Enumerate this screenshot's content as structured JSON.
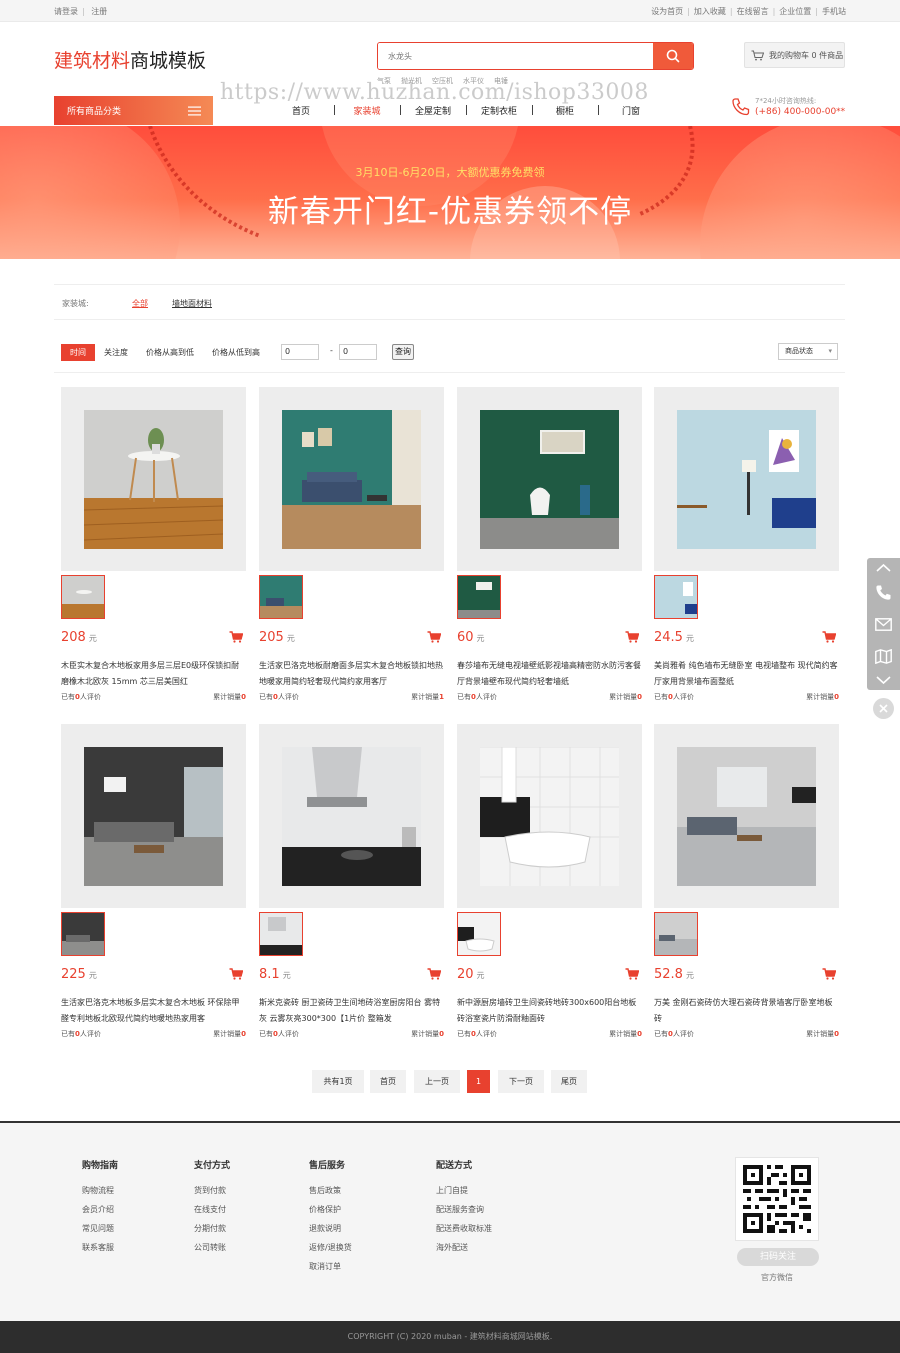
{
  "topbar": {
    "login": "请登录",
    "register": "注册",
    "links": [
      "设为首页",
      "加入收藏",
      "在线留言",
      "企业位置",
      "手机站"
    ]
  },
  "header": {
    "logo_red": "建筑材料",
    "logo_dark": "商城模板",
    "search_placeholder": "水龙头",
    "hotwords": [
      "气泵",
      "抛光机",
      "空压机",
      "水平仪",
      "电锤"
    ],
    "cart_label": "我的购物车 0 件商品",
    "all_categories": "所有商品分类",
    "nav": [
      "首页",
      "家装城",
      "全屋定制",
      "定制衣柜",
      "橱柜",
      "门窗"
    ],
    "nav_active_index": 1,
    "hotline_label": "7*24小时咨询热线:",
    "hotline_number": "(+86) 400-000-00**",
    "watermark": "https://www.huzhan.com/ishop33008"
  },
  "banner": {
    "subtitle": "3月10日-6月20日，大额优惠券免费领",
    "title": "新春开门红-优惠券领不停"
  },
  "filters": {
    "category_label": "家装城:",
    "all": "全部",
    "sub": "墙地面材料",
    "sort": [
      "时间",
      "关注度",
      "价格从高到低",
      "价格从低到高"
    ],
    "price_min": "0",
    "price_max": "0",
    "dash": "-",
    "query": "查询",
    "status": "商品状态"
  },
  "products": [
    {
      "price": "208",
      "unit": "元",
      "name": "木臣实木复合木地板家用多层三层E0级环保锁扣耐磨橡木北欧灰 15mm 芯三层美国红",
      "review_pre": "已有",
      "reviews": "0",
      "review_post": "人评价",
      "sales_label": "累计销量",
      "sales": "0"
    },
    {
      "price": "205",
      "unit": "元",
      "name": "生活家巴洛克地板耐磨面多层实木复合地板锁扣地热地暖家用简约轻奢现代简约家用客厅",
      "review_pre": "已有",
      "reviews": "0",
      "review_post": "人评价",
      "sales_label": "累计销量",
      "sales": "1"
    },
    {
      "price": "60",
      "unit": "元",
      "name": "春莎墙布无缝电视墙壁纸影视墙高精密防水防污客餐厅背景墙壁布现代简约轻奢墙纸",
      "review_pre": "已有",
      "reviews": "0",
      "review_post": "人评价",
      "sales_label": "累计销量",
      "sales": "0"
    },
    {
      "price": "24.5",
      "unit": "元",
      "name": "美尚雅肴 纯色墙布无缝卧室 电视墙整布 现代简约客厅家用背景墙布面整纸",
      "review_pre": "已有",
      "reviews": "0",
      "review_post": "人评价",
      "sales_label": "累计销量",
      "sales": "0"
    },
    {
      "price": "225",
      "unit": "元",
      "name": "生活家巴洛克木地板多层实木复合木地板 环保除甲醛专利地板北欧现代简约地暖地热家用客",
      "review_pre": "已有",
      "reviews": "0",
      "review_post": "人评价",
      "sales_label": "累计销量",
      "sales": "0"
    },
    {
      "price": "8.1",
      "unit": "元",
      "name": "斯米克瓷砖 厨卫瓷砖卫生间地砖浴室厨房阳台 雾特灰 云雾灰亮300*300【1片价 整箱发",
      "review_pre": "已有",
      "reviews": "0",
      "review_post": "人评价",
      "sales_label": "累计销量",
      "sales": "0"
    },
    {
      "price": "20",
      "unit": "元",
      "name": "新中源厨房墙砖卫生间瓷砖地砖300x600阳台地板砖浴室瓷片防滑耐釉面砖",
      "review_pre": "已有",
      "reviews": "0",
      "review_post": "人评价",
      "sales_label": "累计销量",
      "sales": "0"
    },
    {
      "price": "52.8",
      "unit": "元",
      "name": "万美 金刚石瓷砖仿大理石瓷砖背景墙客厅卧室地板砖",
      "review_pre": "已有",
      "reviews": "0",
      "review_post": "人评价",
      "sales_label": "累计销量",
      "sales": "0"
    }
  ],
  "pager": {
    "total": "共有1页",
    "first": "首页",
    "prev": "上一页",
    "current": "1",
    "next": "下一页",
    "last": "尾页"
  },
  "footer": {
    "cols": [
      {
        "title": "购物指南",
        "links": [
          "购物流程",
          "会员介绍",
          "常见问题",
          "联系客服"
        ]
      },
      {
        "title": "支付方式",
        "links": [
          "货到付款",
          "在线支付",
          "分期付款",
          "公司转账"
        ]
      },
      {
        "title": "售后服务",
        "links": [
          "售后政策",
          "价格保护",
          "退款说明",
          "返修/退换货",
          "取消订单"
        ]
      },
      {
        "title": "配送方式",
        "links": [
          "上门自提",
          "配送服务查询",
          "配送费收取标准",
          "海外配送"
        ]
      }
    ],
    "qr_button": "扫码关注",
    "qr_label": "官方微信",
    "copyright": "COPYRIGHT (C) 2020 muban - 建筑材料商城网站模板."
  }
}
